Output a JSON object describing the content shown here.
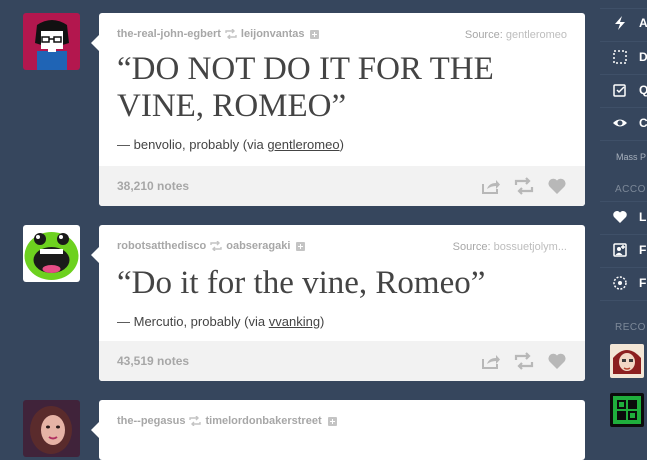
{
  "posts": [
    {
      "blog": "the-real-john-egbert",
      "reblogged_from": "leijonvantas",
      "source_label": "Source:",
      "source_name": "gentleromeo",
      "quote": "“DO NOT DO IT FOR THE VINE, ROMEO”",
      "attribution_prefix": "— benvolio, probably (via ",
      "via": "gentleromeo",
      "attribution_suffix": ")",
      "notes": "38,210 notes"
    },
    {
      "blog": "robotsatthedisco",
      "reblogged_from": "oabseragaki",
      "source_label": "Source:",
      "source_name": "bossuetjolym...",
      "quote": "“Do it for the vine, Romeo”",
      "attribution_prefix": "— Mercutio, probably (via ",
      "via": "vvanking",
      "attribution_suffix": ")",
      "notes": "43,519 notes"
    },
    {
      "blog": "the--pegasus",
      "reblogged_from": "timelordonbakerstreet"
    }
  ],
  "sidebar": {
    "items": [
      {
        "label": "A",
        "icon": "lightning-icon"
      },
      {
        "label": "D",
        "icon": "drafts-icon"
      },
      {
        "label": "Q",
        "icon": "queue-icon"
      },
      {
        "label": "C",
        "icon": "eye-icon"
      }
    ],
    "mass_label": "Mass P",
    "account_header": "ACCO",
    "account_items": [
      {
        "label": "L",
        "icon": "heart-icon"
      },
      {
        "label": "F",
        "icon": "following-icon"
      },
      {
        "label": "F",
        "icon": "settings-icon"
      }
    ],
    "recommended_header": "RECO"
  },
  "colors": {
    "background": "#36465d",
    "card": "#ffffff",
    "footer": "#f2f2f2",
    "muted_text": "#a7a7a7"
  }
}
